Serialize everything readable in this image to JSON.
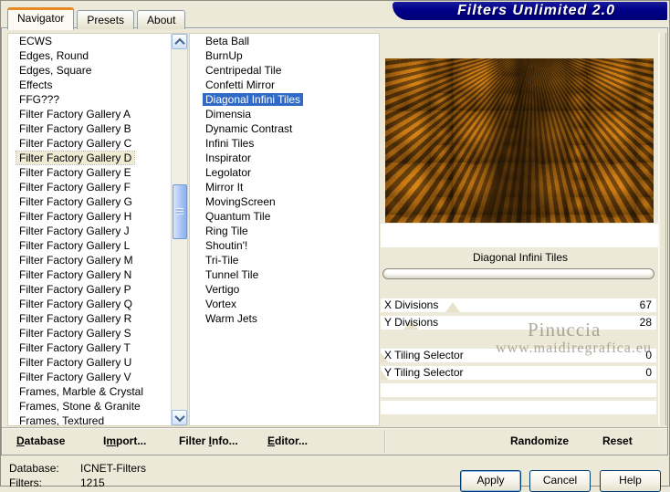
{
  "window": {
    "title": "Filters Unlimited 2.0"
  },
  "tabs": {
    "items": [
      {
        "label": "Navigator",
        "active": true
      },
      {
        "label": "Presets",
        "active": false
      },
      {
        "label": "About",
        "active": false
      }
    ]
  },
  "category_list": {
    "selected_index": 8,
    "items": [
      "ECWS",
      "Edges, Round",
      "Edges, Square",
      "Effects",
      "FFG???",
      "Filter Factory Gallery A",
      "Filter Factory Gallery B",
      "Filter Factory Gallery C",
      "Filter Factory Gallery D",
      "Filter Factory Gallery E",
      "Filter Factory Gallery F",
      "Filter Factory Gallery G",
      "Filter Factory Gallery H",
      "Filter Factory Gallery J",
      "Filter Factory Gallery L",
      "Filter Factory Gallery M",
      "Filter Factory Gallery N",
      "Filter Factory Gallery P",
      "Filter Factory Gallery Q",
      "Filter Factory Gallery R",
      "Filter Factory Gallery S",
      "Filter Factory Gallery T",
      "Filter Factory Gallery U",
      "Filter Factory Gallery V",
      "Frames, Marble & Crystal",
      "Frames, Stone & Granite",
      "Frames, Textured"
    ]
  },
  "filter_list": {
    "selected_index": 4,
    "items": [
      "Beta Ball",
      "BurnUp",
      "Centripedal Tile",
      "Confetti Mirror",
      "Diagonal Infini Tiles",
      "Dimensia",
      "Dynamic Contrast",
      "Infini Tiles",
      "Inspirator",
      "Legolator",
      "Mirror It",
      "MovingScreen",
      "Quantum Tile",
      "Ring Tile",
      "Shoutin'!",
      "Tri-Tile",
      "Tunnel Tile",
      "Vertigo",
      "Vortex",
      "Warm Jets"
    ]
  },
  "right_panel": {
    "filter_title": "Diagonal Infini Tiles",
    "progress_percent": 0,
    "params": [
      {
        "label": "X Divisions",
        "value": "67",
        "thumb_percent": 26
      },
      {
        "label": "Y Divisions",
        "value": "28",
        "thumb_percent": 11
      },
      {
        "label": "X Tiling Selector",
        "value": "0",
        "thumb_percent": 0
      },
      {
        "label": "Y Tiling Selector",
        "value": "0",
        "thumb_percent": 0
      }
    ],
    "watermark": {
      "line1": "Pinuccia",
      "line2": "www.maidiregrafica.eu"
    }
  },
  "bottom_bar": {
    "buttons": [
      {
        "label": "Database",
        "underline_index": 0
      },
      {
        "label": "Import...",
        "underline_index": 1
      },
      {
        "label": "Filter Info...",
        "underline_index": 7
      },
      {
        "label": "Editor...",
        "underline_index": 0
      },
      {
        "label": "Randomize",
        "underline_index": -1
      },
      {
        "label": "Reset",
        "underline_index": -1
      }
    ]
  },
  "status": {
    "database_label": "Database:",
    "database_value": "ICNET-Filters",
    "filters_label": "Filters:",
    "filters_value": "1215"
  },
  "dialog_buttons": [
    {
      "label": "Apply",
      "default": true
    },
    {
      "label": "Cancel",
      "default": false
    },
    {
      "label": "Help",
      "default": false
    }
  ],
  "colors": {
    "dialog_bg": "#ece9d8",
    "banner_navy": "#000089",
    "tab_accent_orange": "#e78a25",
    "selection_blue": "#316ac5",
    "preview_orange": "#c97a13",
    "preview_dark_brown": "#2e1c05"
  }
}
